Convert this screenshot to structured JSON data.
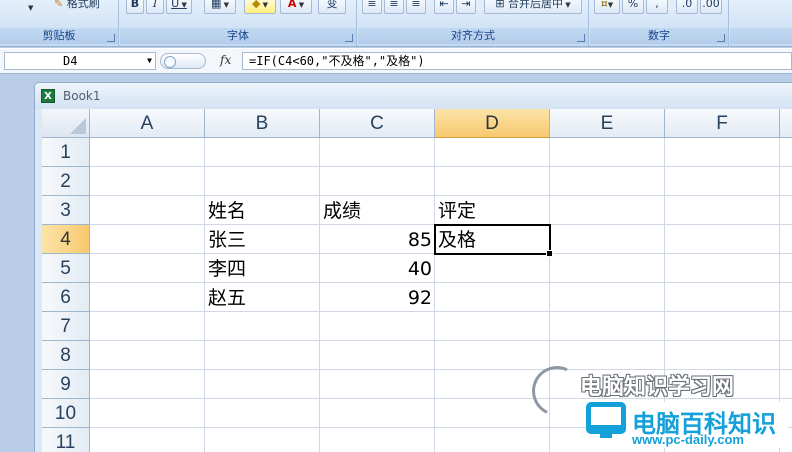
{
  "ribbon": {
    "clipboard": {
      "label": "剪贴板",
      "format_painter": "格式刷"
    },
    "font": {
      "label": "字体",
      "bold": "B",
      "italic": "I",
      "underline": "U",
      "font_color": "A",
      "phonetic": "变"
    },
    "alignment": {
      "label": "对齐方式",
      "merge_center": "合并后居中"
    },
    "number": {
      "label": "数字",
      "percent": "%",
      "comma": ","
    }
  },
  "formula_bar": {
    "name_box": "D4",
    "fx": "fx",
    "formula": "=IF(C4<60,\"不及格\",\"及格\")"
  },
  "workbook": {
    "title": "Book1",
    "icon_letter": "X",
    "columns": [
      "A",
      "B",
      "C",
      "D",
      "E",
      "F"
    ],
    "rows": [
      "1",
      "2",
      "3",
      "4",
      "5",
      "6",
      "7",
      "8",
      "9",
      "10",
      "11"
    ],
    "active_cell": "D4",
    "cells": {
      "B3": "姓名",
      "C3": "成绩",
      "D3": "评定",
      "B4": "张三",
      "C4": "85",
      "D4": "及格",
      "B5": "李四",
      "C5": "40",
      "B6": "赵五",
      "C6": "92"
    }
  },
  "watermark": {
    "line1": "电脑知识学习网",
    "line2": "电脑百科知识",
    "url": "www.pc-daily.com",
    "accent_color": "#14a0d8"
  }
}
